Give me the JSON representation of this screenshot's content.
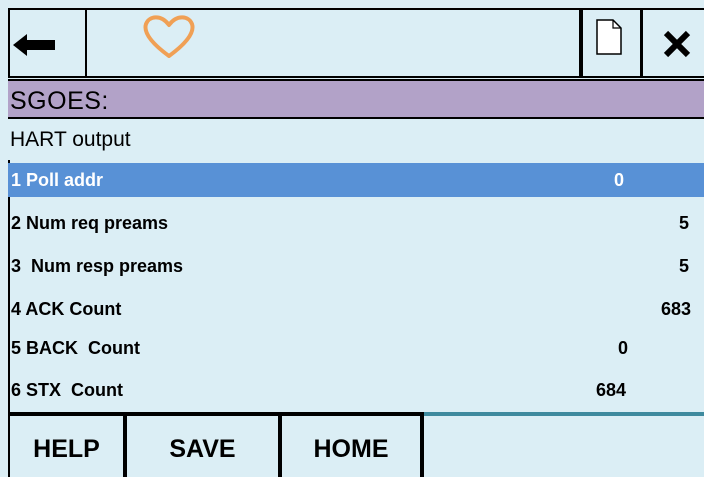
{
  "topbar": {
    "back_icon": "left-arrow-icon",
    "favorite_icon": "heart-icon",
    "document_icon": "document-icon",
    "close_icon": "close-icon"
  },
  "colors": {
    "background": "#dbeef5",
    "title_bar": "#b2a2c8",
    "selected_row": "#5891d6",
    "heart": "#f0a055",
    "accent_line": "#3e8a9e"
  },
  "title": "SGOES:",
  "section": "HART output",
  "params": [
    {
      "label": "1 Poll addr",
      "value": "0",
      "selected": true
    },
    {
      "label": "2 Num req preams",
      "value": "5",
      "selected": false
    },
    {
      "label": "3  Num resp preams",
      "value": "5",
      "selected": false
    },
    {
      "label": "4 ACK Count",
      "value": "683",
      "selected": false
    },
    {
      "label": "5 BACK  Count",
      "value": "0",
      "selected": false
    },
    {
      "label": "6 STX  Count",
      "value": "684",
      "selected": false
    }
  ],
  "softkeys": {
    "help": "HELP",
    "save": "SAVE",
    "home": "HOME"
  }
}
